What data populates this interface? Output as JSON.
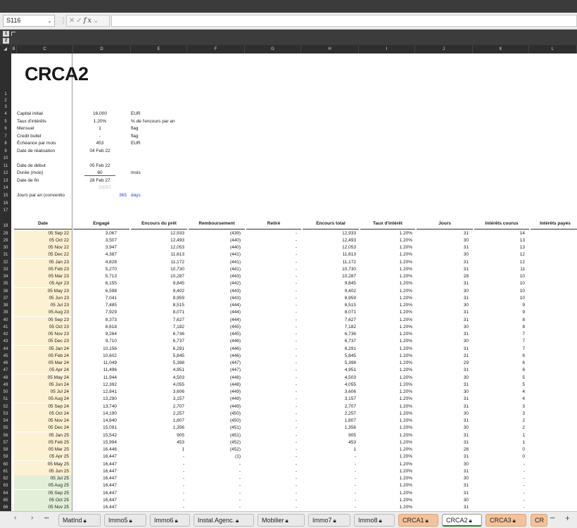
{
  "formula_bar": {
    "cell_ref": "S116",
    "formula": ""
  },
  "outline_levels": [
    "1",
    "2"
  ],
  "columns": [
    "B",
    "C",
    "D",
    "E",
    "F",
    "G",
    "H",
    "I",
    "J",
    "K",
    "L"
  ],
  "sheet": {
    "title": "CRCA2",
    "params": [
      {
        "row": "4",
        "label": "Capital initial",
        "value": "16,000",
        "unit": "EUR"
      },
      {
        "row": "5",
        "label": "Taux d'intérêts",
        "value": "1.20%",
        "unit": "% de l'encours par an"
      },
      {
        "row": "6",
        "label": "Mensuel",
        "value": "1",
        "unit": "flag"
      },
      {
        "row": "7",
        "label": "Credit bullet",
        "value": "-",
        "unit": "flag"
      },
      {
        "row": "8",
        "label": "Échéance par mois",
        "value": "453",
        "unit": "EUR"
      },
      {
        "row": "9",
        "label": "Date de réalisation",
        "value": "04 Feb 22",
        "unit": ""
      },
      {
        "row": "11",
        "label": "Date de début",
        "value": "05 Feb 22",
        "unit": ""
      },
      {
        "row": "12",
        "label": "Durée (mois)",
        "value": "60",
        "unit": "mois"
      },
      {
        "row": "13",
        "label": "Date de fin",
        "value": "28 Feb 27",
        "unit": ""
      }
    ],
    "row14_value": "22007",
    "days_per_year": {
      "label": "Jours par an (conventio",
      "value": "365",
      "unit": "days"
    },
    "headers": [
      "Date",
      "Engagé",
      "Encours du prêt",
      "Remboursement",
      "Retiré",
      "Encours total",
      "Taux d'intérêt",
      "Jours",
      "Intérêts courus",
      "Intérêts payés"
    ],
    "rows": [
      [
        "28",
        "05 Sep 22",
        "3,067",
        "12,933",
        "(439)",
        "-",
        "12,933",
        "1.20%",
        "31",
        "14"
      ],
      [
        "29",
        "05 Oct 22",
        "3,507",
        "12,493",
        "(440)",
        "-",
        "12,493",
        "1.20%",
        "30",
        "13"
      ],
      [
        "30",
        "05 Nov 22",
        "3,947",
        "12,053",
        "(440)",
        "-",
        "12,053",
        "1.20%",
        "31",
        "13"
      ],
      [
        "31",
        "05 Dec 22",
        "4,387",
        "11,613",
        "(441)",
        "-",
        "11,613",
        "1.20%",
        "30",
        "12"
      ],
      [
        "32",
        "05 Jan 23",
        "4,828",
        "11,172",
        "(441)",
        "-",
        "11,172",
        "1.20%",
        "31",
        "12"
      ],
      [
        "33",
        "05 Feb 23",
        "5,270",
        "10,730",
        "(441)",
        "-",
        "10,730",
        "1.20%",
        "31",
        "11"
      ],
      [
        "34",
        "05 Mar 23",
        "5,713",
        "10,287",
        "(443)",
        "-",
        "10,287",
        "1.20%",
        "28",
        "10"
      ],
      [
        "35",
        "05 Apr 23",
        "6,155",
        "9,845",
        "(442)",
        "-",
        "9,845",
        "1.20%",
        "31",
        "10"
      ],
      [
        "36",
        "05 May 23",
        "6,598",
        "9,402",
        "(443)",
        "-",
        "9,402",
        "1.20%",
        "30",
        "10"
      ],
      [
        "37",
        "05 Jun 23",
        "7,041",
        "8,959",
        "(443)",
        "-",
        "8,959",
        "1.20%",
        "31",
        "10"
      ],
      [
        "38",
        "05 Jul 23",
        "7,485",
        "8,515",
        "(444)",
        "-",
        "8,515",
        "1.20%",
        "30",
        "9"
      ],
      [
        "39",
        "05 Aug 23",
        "7,929",
        "8,071",
        "(444)",
        "-",
        "8,071",
        "1.20%",
        "31",
        "9"
      ],
      [
        "40",
        "05 Sep 23",
        "8,373",
        "7,627",
        "(444)",
        "-",
        "7,627",
        "1.20%",
        "31",
        "8"
      ],
      [
        "41",
        "05 Oct 23",
        "8,818",
        "7,182",
        "(445)",
        "-",
        "7,182",
        "1.20%",
        "30",
        "8"
      ],
      [
        "42",
        "05 Nov 23",
        "9,264",
        "6,736",
        "(445)",
        "-",
        "6,736",
        "1.20%",
        "31",
        "7"
      ],
      [
        "43",
        "05 Dec 23",
        "9,710",
        "6,737",
        "(446)",
        "-",
        "6,737",
        "1.20%",
        "30",
        "7"
      ],
      [
        "44",
        "05 Jan 24",
        "10,156",
        "6,291",
        "(446)",
        "-",
        "6,291",
        "1.20%",
        "31",
        "7"
      ],
      [
        "45",
        "05 Feb 24",
        "10,602",
        "5,845",
        "(446)",
        "-",
        "5,845",
        "1.20%",
        "31",
        "6"
      ],
      [
        "46",
        "05 Mar 24",
        "11,049",
        "5,398",
        "(447)",
        "-",
        "5,398",
        "1.20%",
        "29",
        "6"
      ],
      [
        "47",
        "05 Apr 24",
        "11,496",
        "4,951",
        "(447)",
        "-",
        "4,951",
        "1.20%",
        "31",
        "6"
      ],
      [
        "48",
        "05 May 24",
        "11,944",
        "4,503",
        "(448)",
        "-",
        "4,503",
        "1.20%",
        "30",
        "5"
      ],
      [
        "49",
        "05 Jun 24",
        "12,392",
        "4,055",
        "(448)",
        "-",
        "4,055",
        "1.20%",
        "31",
        "5"
      ],
      [
        "50",
        "05 Jul 24",
        "12,841",
        "3,606",
        "(449)",
        "-",
        "3,606",
        "1.20%",
        "30",
        "4"
      ],
      [
        "51",
        "05 Aug 24",
        "13,290",
        "3,157",
        "(449)",
        "-",
        "3,157",
        "1.20%",
        "31",
        "4"
      ],
      [
        "52",
        "05 Sep 24",
        "13,740",
        "2,707",
        "(449)",
        "-",
        "2,707",
        "1.20%",
        "31",
        "3"
      ],
      [
        "53",
        "05 Oct 24",
        "14,190",
        "2,257",
        "(450)",
        "-",
        "2,257",
        "1.20%",
        "30",
        "3"
      ],
      [
        "54",
        "05 Nov 24",
        "14,640",
        "1,807",
        "(450)",
        "-",
        "1,807",
        "1.20%",
        "31",
        "2"
      ],
      [
        "55",
        "05 Dec 24",
        "15,091",
        "1,356",
        "(451)",
        "-",
        "1,356",
        "1.20%",
        "30",
        "2"
      ],
      [
        "56",
        "05 Jan 25",
        "15,542",
        "905",
        "(451)",
        "-",
        "905",
        "1.20%",
        "31",
        "1"
      ],
      [
        "57",
        "05 Feb 25",
        "15,994",
        "453",
        "(452)",
        "-",
        "453",
        "1.20%",
        "31",
        "1"
      ],
      [
        "58",
        "05 Mar 25",
        "16,446",
        "1",
        "(452)",
        "-",
        "1",
        "1.20%",
        "28",
        "0"
      ],
      [
        "59",
        "05 Apr 25",
        "16,447",
        "-",
        "(1)",
        "-",
        "-",
        "1.20%",
        "31",
        "0"
      ],
      [
        "60",
        "05 May 25",
        "16,447",
        "-",
        "-",
        "-",
        "-",
        "1.20%",
        "30",
        "-"
      ],
      [
        "61",
        "05 Jun 25",
        "16,447",
        "-",
        "-",
        "-",
        "-",
        "1.20%",
        "31",
        "-"
      ],
      [
        "62",
        "05 Jul 25",
        "16,447",
        "-",
        "-",
        "-",
        "-",
        "1.20%",
        "30",
        "-"
      ],
      [
        "63",
        "05 Aug 25",
        "16,447",
        "-",
        "-",
        "-",
        "-",
        "1.20%",
        "31",
        "-"
      ],
      [
        "64",
        "05 Sep 25",
        "16,447",
        "-",
        "-",
        "-",
        "-",
        "1.20%",
        "31",
        "-"
      ],
      [
        "65",
        "05 Oct 25",
        "16,447",
        "-",
        "-",
        "-",
        "-",
        "1.20%",
        "30",
        "-"
      ],
      [
        "66",
        "05 Nov 25",
        "16,447",
        "-",
        "-",
        "-",
        "-",
        "1.20%",
        "31",
        "-"
      ]
    ]
  },
  "tabs": [
    {
      "label": "MatInd",
      "style": "normal",
      "lock": true
    },
    {
      "label": "Immo5",
      "style": "normal",
      "lock": true
    },
    {
      "label": "Immo6",
      "style": "normal",
      "lock": true
    },
    {
      "label": "Instal.Agenc.",
      "style": "normal",
      "lock": true
    },
    {
      "label": "Mobilier",
      "style": "normal",
      "lock": true
    },
    {
      "label": "Immo7",
      "style": "normal",
      "lock": true
    },
    {
      "label": "Immo8",
      "style": "normal",
      "lock": true
    },
    {
      "label": "CRCA1",
      "style": "orange",
      "lock": true
    },
    {
      "label": "CRCA2",
      "style": "active",
      "lock": true
    },
    {
      "label": "CRCA3",
      "style": "orange",
      "lock": true
    },
    {
      "label": "CR",
      "style": "orange",
      "lock": false
    }
  ],
  "tab_nav": {
    "prev": "‹",
    "next": "›",
    "more_left": "•••",
    "more_right": "•••",
    "add": "+"
  },
  "colors": {
    "date_fill": "#fdf1d4",
    "date_fill_green": "#e3efd9",
    "active_tab_accent": "#2e7d32",
    "orange_tab": "#f3c29a",
    "blue_value": "#1f3fcf"
  }
}
